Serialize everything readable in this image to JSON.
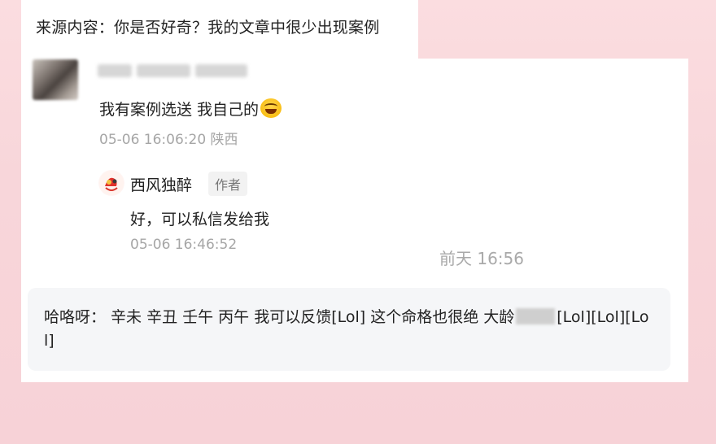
{
  "source_line": "来源内容：你是否好奇？我的文章中很少出现案例",
  "comment": {
    "text": "我有案例选送 我自己的",
    "emoji": "laughing-tears-emoji",
    "meta": "05-06 16:06:20 陕西"
  },
  "reply": {
    "author": "西风独醉",
    "badge": "作者",
    "text": "好，可以私信发给我",
    "time": "05-06 16:46:52"
  },
  "chat": {
    "day_stamp": "前天 16:56",
    "message_before": "哈咯呀： 辛未 辛丑 壬午 丙午 我可以反馈[Lol] 这个命格也很绝 大龄",
    "message_after": "[Lol][Lol][Lol]"
  },
  "colors": {
    "background": "#f8d6da",
    "card": "#ffffff",
    "bubble": "#f5f6f8",
    "meta_text": "#a6a6a6"
  }
}
